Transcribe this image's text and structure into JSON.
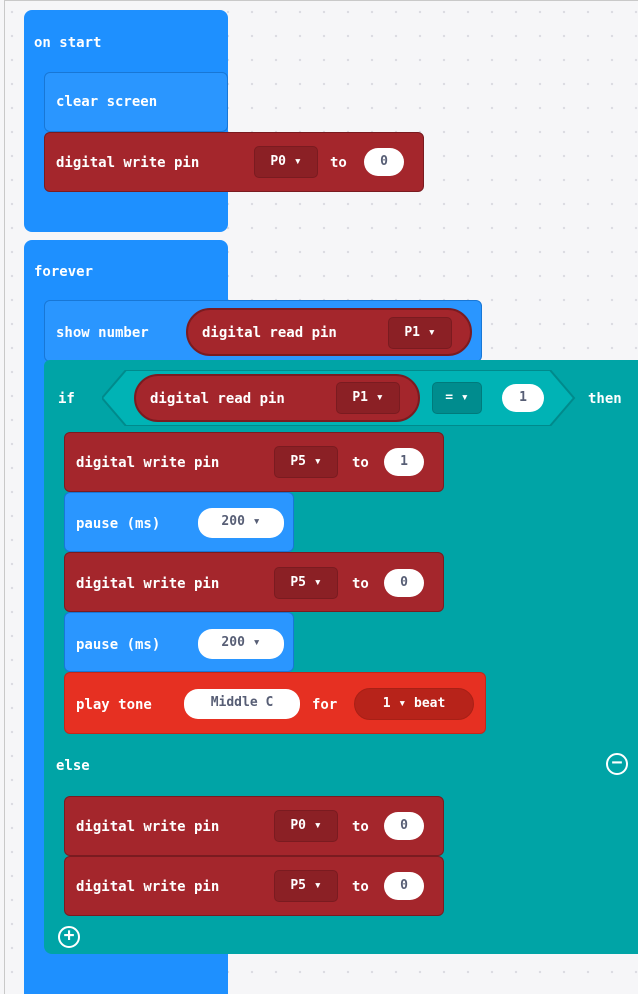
{
  "on_start": {
    "label": "on start",
    "clear_screen": "clear screen",
    "digital_write": {
      "label": "digital write pin",
      "pin": "P0 ▾",
      "to": "to",
      "value": "0"
    }
  },
  "forever": {
    "label": "forever",
    "show_number": {
      "label": "show number",
      "read_label": "digital read pin",
      "pin": "P1 ▾"
    },
    "if_block": {
      "if_label": "if",
      "then_label": "then",
      "else_label": "else",
      "condition": {
        "read_label": "digital read pin",
        "pin": "P1 ▾",
        "operator": "= ▾",
        "value": "1"
      },
      "then_body": [
        {
          "label": "digital write pin",
          "pin": "P5 ▾",
          "to": "to",
          "value": "1"
        },
        {
          "label": "pause (ms)",
          "value": "200 ▾"
        },
        {
          "label": "digital write pin",
          "pin": "P5 ▾",
          "to": "to",
          "value": "0"
        },
        {
          "label": "pause (ms)",
          "value": "200 ▾"
        },
        {
          "label": "play tone",
          "note": "Middle C",
          "for": "for",
          "beat": "1 ▾ beat"
        }
      ],
      "else_body": [
        {
          "label": "digital write pin",
          "pin": "P0 ▾",
          "to": "to",
          "value": "0"
        },
        {
          "label": "digital write pin",
          "pin": "P5 ▾",
          "to": "to",
          "value": "0"
        }
      ],
      "remove_else_icon": "minus-circle-icon",
      "add_else_icon": "plus-circle-icon"
    }
  },
  "colors": {
    "basic": "#1e90ff",
    "pins": "#a4262c",
    "logic": "#00a4a6",
    "music": "#e63022",
    "workspace": "#f6f6f8"
  }
}
